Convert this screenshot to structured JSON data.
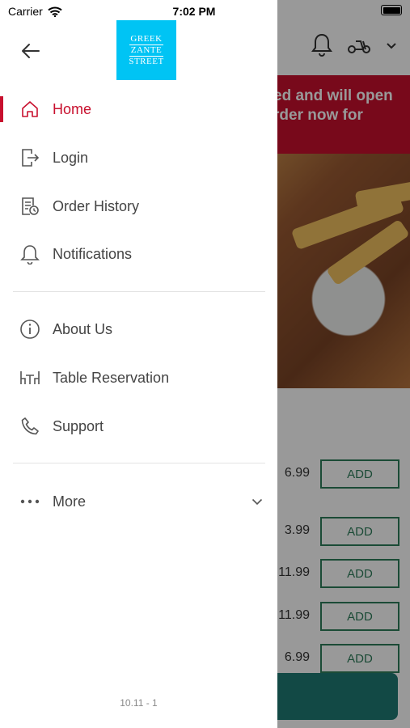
{
  "status_bar": {
    "carrier": "Carrier",
    "time": "7:02 PM"
  },
  "logo": {
    "line1": "GREEK",
    "line2": "ZANTE",
    "line3": "STREET"
  },
  "drawer": {
    "menu_primary": [
      {
        "label": "Home",
        "icon": "home-icon",
        "active": true
      },
      {
        "label": "Login",
        "icon": "login-icon"
      },
      {
        "label": "Order History",
        "icon": "order-history-icon"
      },
      {
        "label": "Notifications",
        "icon": "bell-icon"
      }
    ],
    "menu_secondary": [
      {
        "label": "About Us",
        "icon": "info-icon"
      },
      {
        "label": "Table Reservation",
        "icon": "table-reservation-icon"
      },
      {
        "label": "Support",
        "icon": "phone-icon"
      }
    ],
    "more_label": "More",
    "version": "10.11 - 1"
  },
  "background": {
    "banner_line1": "ed and will open",
    "banner_line2": "rder now for",
    "items": [
      {
        "price": "6.99",
        "button": "ADD"
      },
      {
        "price": "3.99",
        "button": "ADD"
      },
      {
        "price": "11.99",
        "button": "ADD"
      },
      {
        "price": "11.99",
        "button": "ADD"
      },
      {
        "price": "6.99",
        "button": "ADD"
      }
    ]
  },
  "colors": {
    "accent": "#c8102e",
    "logo_bg": "#00c4f4",
    "add_green": "#2e7d5b"
  }
}
